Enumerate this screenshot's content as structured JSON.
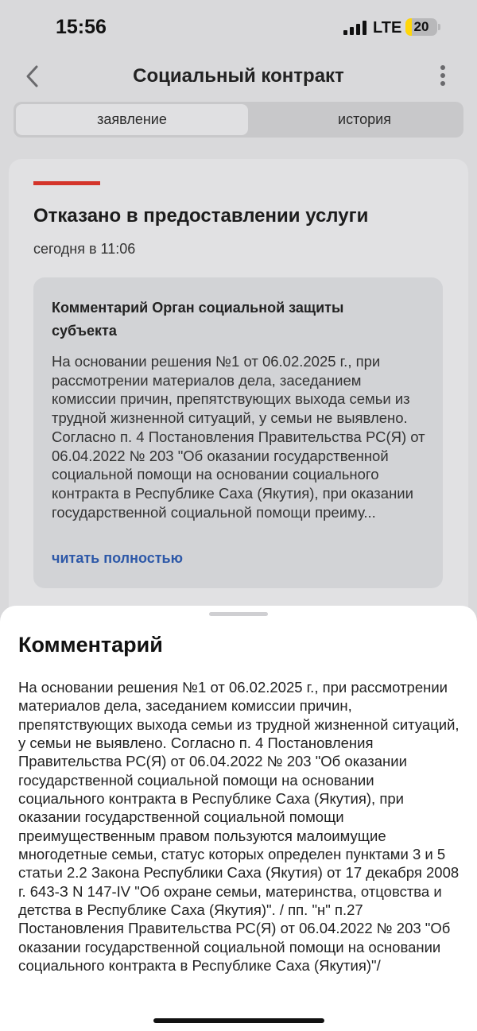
{
  "status_bar": {
    "time": "15:56",
    "network": "LTE",
    "battery": "20",
    "battery_level": 0.2
  },
  "nav": {
    "title": "Социальный контракт",
    "back_icon": "chevron-left-icon",
    "more_icon": "more-vertical-icon"
  },
  "tabs": [
    {
      "label": "заявление",
      "active": true
    },
    {
      "label": "история",
      "active": false
    }
  ],
  "status_card": {
    "accent_color": "#d4342a",
    "title": "Отказано в предоставлении услуги",
    "time": "сегодня в 11:06",
    "comment": {
      "title": "Комментарий Орган социальной защиты субъекта",
      "text": "На основании решения №1 от 06.02.2025 г., при рассмотрении материалов дела, заседанием комиссии причин, препятствующих выхода семьи из трудной жизненной ситуаций, у семьи не выявлено. Согласно п. 4 Постановления Правительства РС(Я) от 06.04.2022 № 203 \"Об оказании государственной социальной помощи на основании социального контракта в Республике Саха (Якутия), при оказании государственной социальной помощи преиму...",
      "read_more": "читать полностью",
      "link_color": "#2d58a8"
    }
  },
  "sheet": {
    "title": "Комментарий",
    "text": "На основании решения №1 от 06.02.2025 г., при рассмотрении материалов дела, заседанием комиссии причин, препятствующих выхода семьи из трудной жизненной ситуаций, у семьи не выявлено. Согласно п. 4 Постановления Правительства РС(Я) от 06.04.2022 № 203 \"Об оказании государственной социальной помощи на основании социального контракта в Республике Саха (Якутия), при оказании государственной социальной помощи преимущественным правом пользуются малоимущие многодетные семьи, статус которых определен пунктами 3 и 5 статьи 2.2 Закона Республики Саха (Якутия) от 17 декабря 2008 г. 643-З N 147-IV \"Об охране семьи, материнства, отцовства и детства в Республике Саха (Якутия)\". / пп. \"н\" п.27 Постановления Правительства РС(Я) от 06.04.2022 № 203 \"Об оказании государственной социальной помощи на основании социального контракта в Республике Саха (Якутия)\"/"
  }
}
